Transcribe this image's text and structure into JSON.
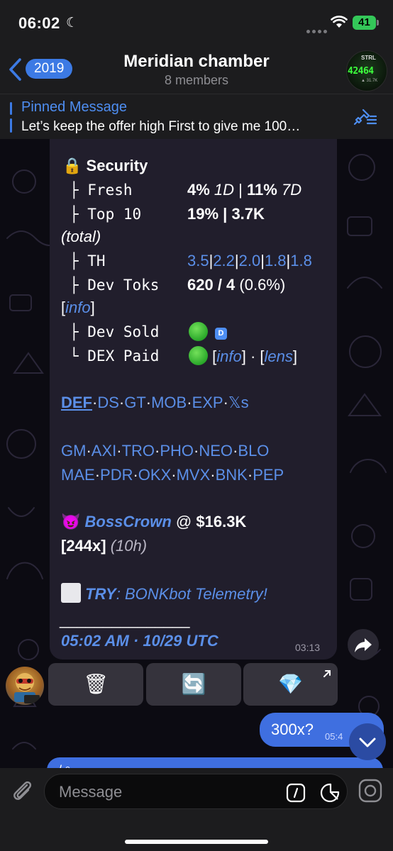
{
  "status": {
    "time": "06:02",
    "battery": "41"
  },
  "header": {
    "back_badge": "2019",
    "title": "Meridian chamber",
    "subtitle": "8 members",
    "avatar_text": [
      "STRL",
      "42464",
      "▲ 31.7K"
    ]
  },
  "pinned": {
    "title": "Pinned Message",
    "text": "Let’s keep the offer high First to give me 100…"
  },
  "message": {
    "security_label": "Security",
    "fresh_label": "├ Fresh",
    "fresh_a": "4%",
    "fresh_a_span": "1D",
    "fresh_b": "11%",
    "fresh_b_span": "7D",
    "top10_label": "├ Top 10",
    "top10_pct": "19%",
    "top10_amt": "3.7K",
    "total_label": "(total)",
    "th_label": "├ TH",
    "th_values": [
      "3.5",
      "2.2",
      "2.0",
      "1.8",
      "1.8"
    ],
    "devtoks_label": "├ Dev Toks",
    "devtoks_value": "620 / 4",
    "devtoks_pct": "(0.6%)",
    "info_link": "info",
    "devsold_label": "├ Dev Sold",
    "devsold_badge": "D",
    "dexpaid_label": "└ DEX Paid",
    "lens_link": "lens",
    "links_row1": [
      "DEF",
      "DS",
      "GT",
      "MOB",
      "EXP",
      "𝕏s"
    ],
    "links_row2": [
      "GM",
      "AXI",
      "TRO",
      "PHO",
      "NEO",
      "BLO"
    ],
    "links_row3": [
      "MAE",
      "PDR",
      "OKX",
      "MVX",
      "BNK",
      "PEP"
    ],
    "caller_emoji": "😈",
    "caller_name": "BossCrown",
    "caller_at": "@",
    "caller_mc": "$16.3K",
    "multiplier": "[244x]",
    "age": "(10h)",
    "try_label": "TRY",
    "try_text": ": BONKbot Telemetry!",
    "underline": "_______________",
    "footer_time": "05:02 AM · 10/29 UTC",
    "sent_time": "03:13"
  },
  "buttons": {
    "delete": "🗑",
    "refresh": "🔄",
    "premium": "💎"
  },
  "outgoing": {
    "text": "300x?",
    "time": "05:4"
  },
  "partial": {
    "text": "/ ᵉ ~"
  },
  "input": {
    "placeholder": "Message"
  },
  "colors": {
    "accent": "#3c7ae4",
    "link": "#5b8fe8",
    "bubble": "#211e2c",
    "outgoing": "#3f6fe0"
  }
}
